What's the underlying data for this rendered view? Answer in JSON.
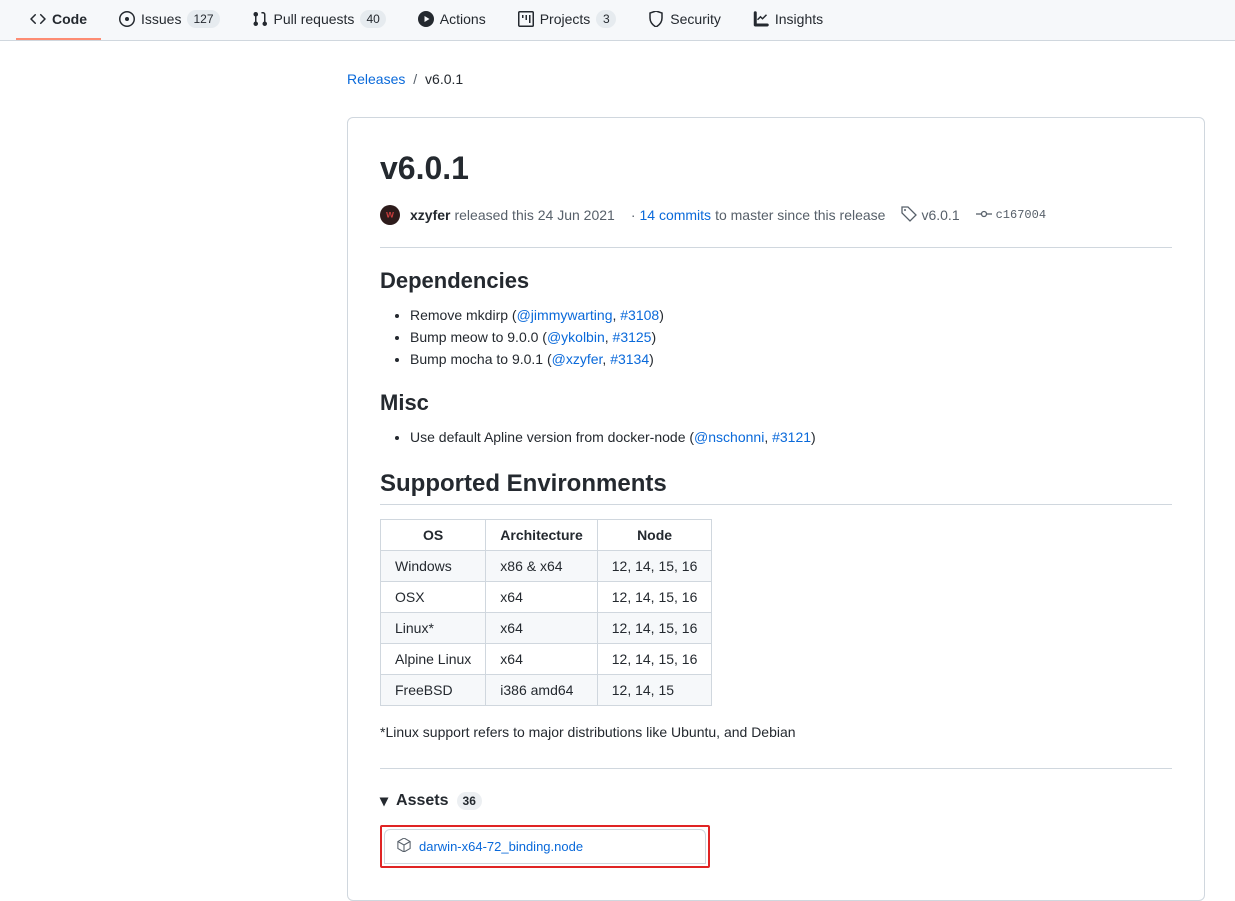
{
  "tabs": {
    "code": "Code",
    "issues": "Issues",
    "issues_count": "127",
    "pulls": "Pull requests",
    "pulls_count": "40",
    "actions": "Actions",
    "projects": "Projects",
    "projects_count": "3",
    "security": "Security",
    "insights": "Insights"
  },
  "breadcrumb": {
    "releases": "Releases",
    "current": "v6.0.1"
  },
  "release": {
    "title": "v6.0.1",
    "author": "xzyfer",
    "released_text": " released this 24 Jun 2021",
    "commits_prefix": "· ",
    "commits_link": "14 commits",
    "commits_suffix": " to master since this release",
    "tag": "v6.0.1",
    "commit": "c167004"
  },
  "sections": {
    "dependencies": "Dependencies",
    "misc": "Misc",
    "supported": "Supported Environments"
  },
  "deps": [
    {
      "text": "Remove mkdirp (",
      "mention": "@jimmywarting",
      "sep": ", ",
      "issue": "#3108",
      "end": ")"
    },
    {
      "text": "Bump meow to 9.0.0 (",
      "mention": "@ykolbin",
      "sep": ", ",
      "issue": "#3125",
      "end": ")"
    },
    {
      "text": "Bump mocha to 9.0.1 (",
      "mention": "@xzyfer",
      "sep": ", ",
      "issue": "#3134",
      "end": ")"
    }
  ],
  "misc": [
    {
      "text": "Use default Apline version from docker-node (",
      "mention": "@nschonni",
      "sep": ", ",
      "issue": "#3121",
      "end": ")"
    }
  ],
  "table": {
    "headers": {
      "os": "OS",
      "arch": "Architecture",
      "node": "Node"
    },
    "rows": [
      {
        "os": "Windows",
        "arch": "x86 & x64",
        "node": "12, 14, 15, 16"
      },
      {
        "os": "OSX",
        "arch": "x64",
        "node": "12, 14, 15, 16"
      },
      {
        "os": "Linux*",
        "arch": "x64",
        "node": "12, 14, 15, 16"
      },
      {
        "os": "Alpine Linux",
        "arch": "x64",
        "node": "12, 14, 15, 16"
      },
      {
        "os": "FreeBSD",
        "arch": "i386 amd64",
        "node": "12, 14, 15"
      }
    ],
    "footnote": "*Linux support refers to major distributions like Ubuntu, and Debian"
  },
  "assets": {
    "label": "Assets",
    "count": "36",
    "first": "darwin-x64-72_binding.node"
  }
}
